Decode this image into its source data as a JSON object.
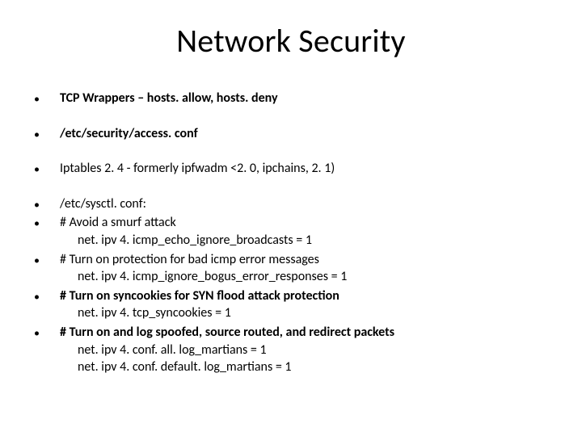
{
  "title": "Network Security",
  "bullets": {
    "b1": "TCP Wrappers – hosts. allow, hosts. deny",
    "b2": "/etc/security/access. conf",
    "b3": "Iptables 2. 4 - formerly ipfwadm <2. 0, ipchains, 2. 1)",
    "b4": "/etc/sysctl. conf:",
    "b5": "# Avoid a smurf attack",
    "b5s": "net. ipv 4. icmp_echo_ignore_broadcasts = 1",
    "b6": "# Turn on protection for bad icmp error messages",
    "b6s": "net. ipv 4. icmp_ignore_bogus_error_responses = 1",
    "b7": "# Turn on syncookies for SYN flood attack protection",
    "b7s": "net. ipv 4. tcp_syncookies = 1",
    "b8": "# Turn on and log spoofed, source routed, and redirect packets",
    "b8s1": "net. ipv 4. conf. all. log_martians = 1",
    "b8s2": "net. ipv 4. conf. default. log_martians = 1"
  }
}
